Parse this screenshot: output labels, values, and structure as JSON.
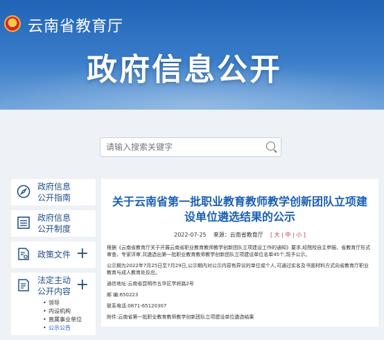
{
  "header": {
    "site_name": "云南省教育厅",
    "section_title": "政府信息公开"
  },
  "search": {
    "placeholder": "请输入搜索关键字"
  },
  "sidebar": {
    "items": [
      {
        "label_line1": "政府信息",
        "label_line2": "公开指南",
        "icon": "compass-icon"
      },
      {
        "label_line1": "政府信息",
        "label_line2": "公开制度",
        "icon": "document-list-icon"
      },
      {
        "label": "政策文件",
        "icon": "policy-file-icon",
        "expand": "+"
      },
      {
        "label_line1": "法定主动",
        "label_line2": "公开内容",
        "icon": "edit-document-icon",
        "expand": "+",
        "subitems": [
          "领导",
          "内设机构",
          "直属事业单位",
          "公示公告"
        ]
      }
    ]
  },
  "article": {
    "title": "关于云南省第一批职业教育教师教学创新团队立项建设单位遴选结果的公示",
    "date": "2022-07-25",
    "source": "来源：云南省教育厅",
    "font_size_label": "[ 大 | 中 | 小 ]",
    "paragraphs": [
      "根据《云南省教育厅关于开展云南省职业教育教师教学创新团队立项建设工作的通知》要求,经院校自主申报、省教育厅形式审查、专家评审,共遴选出第一批职业教育教师教学创新团队立项建设单位名单45个,现予公示。",
      "公示期为2022年7月25日至7月29日,公示期内对公示内容有异议的单位或个人,可通过实名及书面材料方式向省教育厅职业教育与成人教育处反应。",
      "通信地址:云南省昆明市五华区学府路2号",
      "邮 编:650223",
      "联系电话:0871-65120307",
      "附件:云南省第一批职业教育教师教学创新团队立项建设单位遴选结果"
    ]
  },
  "colors": {
    "banner": "#1f63b6",
    "title_blue": "#1a5fb4",
    "sidebar_text": "#1f4f86"
  }
}
